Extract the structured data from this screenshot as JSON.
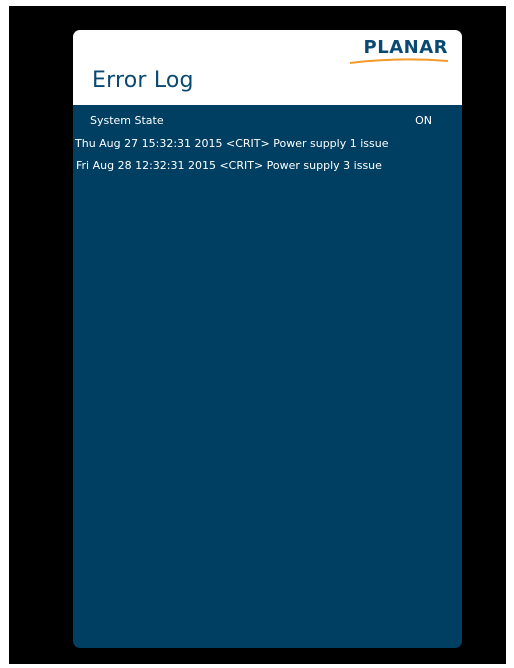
{
  "window": {
    "title": "Error Log"
  },
  "brand": {
    "name": "PLANAR",
    "swoosh_color": "#f39a2b",
    "text_color": "#0a4a72"
  },
  "colors": {
    "panel_background": "#003f62",
    "header_background": "#ffffff",
    "frame_background": "#000000",
    "text": "#ffffff"
  },
  "system_state": {
    "label": "System State",
    "value": "ON"
  },
  "log_entries": [
    {
      "text": "Thu Aug 27 15:32:31 2015 <CRIT> Power supply 1 issue"
    },
    {
      "text": "Fri Aug 28 12:32:31 2015 <CRIT> Power supply 3 issue"
    }
  ]
}
